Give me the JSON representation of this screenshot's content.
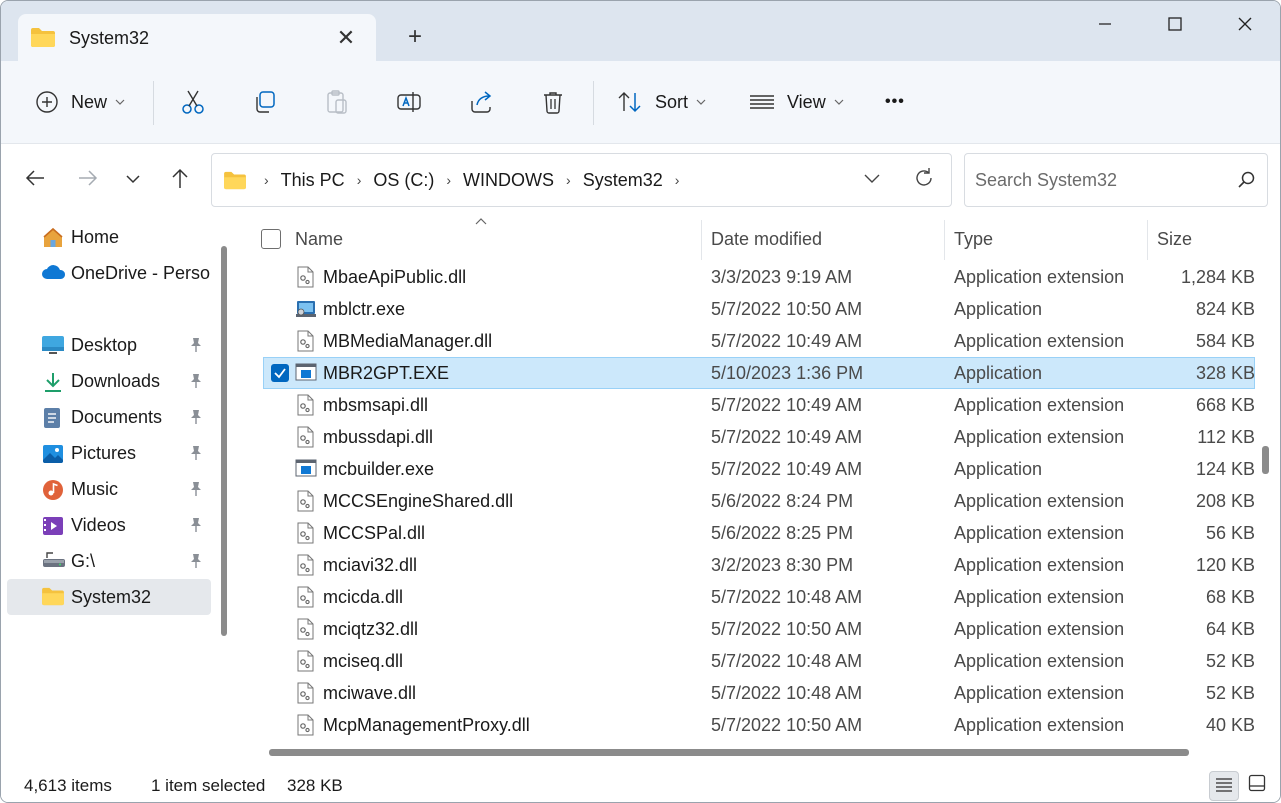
{
  "window": {
    "tab_title": "System32",
    "new_tab_symbol": "+",
    "close_symbol": "✕",
    "minimize_symbol": "—",
    "maximize_symbol": "☐"
  },
  "toolbar": {
    "new_label": "New",
    "sort_label": "Sort",
    "view_label": "View",
    "more_symbol": "•••",
    "icons": [
      "cut-icon",
      "copy-icon",
      "paste-icon",
      "rename-icon",
      "share-icon",
      "delete-icon"
    ]
  },
  "address": {
    "crumbs": [
      "This PC",
      "OS (C:)",
      "WINDOWS",
      "System32"
    ]
  },
  "search": {
    "placeholder": "Search System32"
  },
  "sidebar": {
    "items": [
      {
        "label": "Home",
        "icon": "home-icon",
        "pinned": false
      },
      {
        "label": "OneDrive - Personal",
        "icon": "onedrive-icon",
        "pinned": false
      },
      {
        "label": "Desktop",
        "icon": "desktop-icon",
        "pinned": true
      },
      {
        "label": "Downloads",
        "icon": "downloads-icon",
        "pinned": true
      },
      {
        "label": "Documents",
        "icon": "documents-icon",
        "pinned": true
      },
      {
        "label": "Pictures",
        "icon": "pictures-icon",
        "pinned": true
      },
      {
        "label": "Music",
        "icon": "music-icon",
        "pinned": true
      },
      {
        "label": "Videos",
        "icon": "videos-icon",
        "pinned": true
      },
      {
        "label": "G:\\",
        "icon": "drive-icon",
        "pinned": true
      },
      {
        "label": "System32",
        "icon": "folder-icon",
        "pinned": false,
        "selected": true
      }
    ]
  },
  "columns": {
    "name": "Name",
    "date": "Date modified",
    "type": "Type",
    "size": "Size"
  },
  "files": [
    {
      "name": "MbaeApiPublic.dll",
      "date": "3/3/2023 9:19 AM",
      "type": "Application extension",
      "size": "1,284 KB",
      "kind": "dll"
    },
    {
      "name": "mblctr.exe",
      "date": "5/7/2022 10:50 AM",
      "type": "Application",
      "size": "824 KB",
      "kind": "mblctr"
    },
    {
      "name": "MBMediaManager.dll",
      "date": "5/7/2022 10:49 AM",
      "type": "Application extension",
      "size": "584 KB",
      "kind": "dll"
    },
    {
      "name": "MBR2GPT.EXE",
      "date": "5/10/2023 1:36 PM",
      "type": "Application",
      "size": "328 KB",
      "kind": "exe",
      "selected": true
    },
    {
      "name": "mbsmsapi.dll",
      "date": "5/7/2022 10:49 AM",
      "type": "Application extension",
      "size": "668 KB",
      "kind": "dll"
    },
    {
      "name": "mbussdapi.dll",
      "date": "5/7/2022 10:49 AM",
      "type": "Application extension",
      "size": "112 KB",
      "kind": "dll"
    },
    {
      "name": "mcbuilder.exe",
      "date": "5/7/2022 10:49 AM",
      "type": "Application",
      "size": "124 KB",
      "kind": "exe"
    },
    {
      "name": "MCCSEngineShared.dll",
      "date": "5/6/2022 8:24 PM",
      "type": "Application extension",
      "size": "208 KB",
      "kind": "dll"
    },
    {
      "name": "MCCSPal.dll",
      "date": "5/6/2022 8:25 PM",
      "type": "Application extension",
      "size": "56 KB",
      "kind": "dll"
    },
    {
      "name": "mciavi32.dll",
      "date": "3/2/2023 8:30 PM",
      "type": "Application extension",
      "size": "120 KB",
      "kind": "dll"
    },
    {
      "name": "mcicda.dll",
      "date": "5/7/2022 10:48 AM",
      "type": "Application extension",
      "size": "68 KB",
      "kind": "dll"
    },
    {
      "name": "mciqtz32.dll",
      "date": "5/7/2022 10:50 AM",
      "type": "Application extension",
      "size": "64 KB",
      "kind": "dll"
    },
    {
      "name": "mciseq.dll",
      "date": "5/7/2022 10:48 AM",
      "type": "Application extension",
      "size": "52 KB",
      "kind": "dll"
    },
    {
      "name": "mciwave.dll",
      "date": "5/7/2022 10:48 AM",
      "type": "Application extension",
      "size": "52 KB",
      "kind": "dll"
    },
    {
      "name": "McpManagementProxy.dll",
      "date": "5/7/2022 10:50 AM",
      "type": "Application extension",
      "size": "40 KB",
      "kind": "dll"
    }
  ],
  "status": {
    "item_count": "4,613 items",
    "selection": "1 item selected",
    "selection_size": "328 KB"
  },
  "colors": {
    "accent": "#0067c0",
    "selection_bg": "#cce8fb",
    "titlebar_bg": "#dde5ef",
    "toolbar_bg": "#f4f7fb",
    "folder_yellow": "#f5c23e"
  }
}
